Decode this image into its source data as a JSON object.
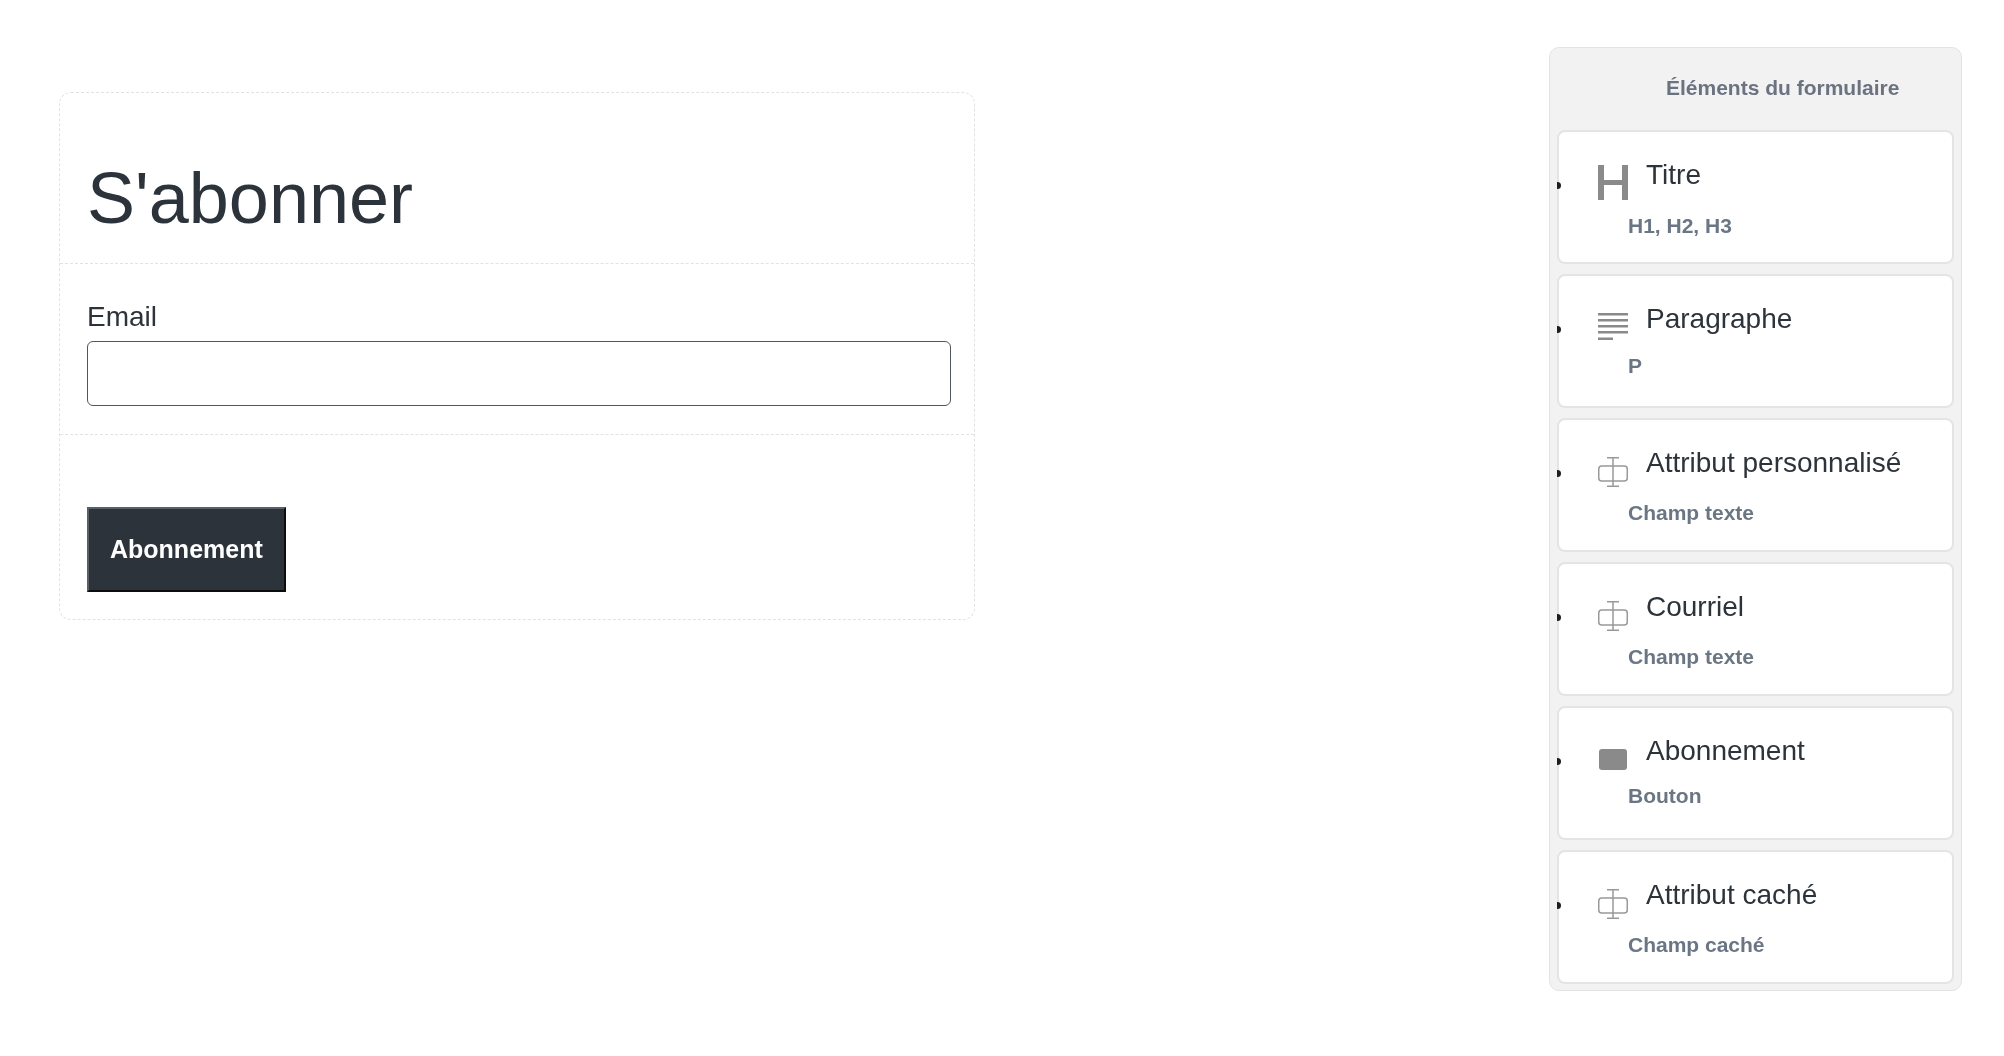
{
  "form": {
    "title": "S'abonner",
    "fields": [
      {
        "label": "Email"
      }
    ],
    "submit_button": "Abonnement"
  },
  "elements_panel": {
    "title": "Éléments du formulaire",
    "items": [
      {
        "kind": "heading",
        "name": "Titre",
        "type": "H1, H2, H3"
      },
      {
        "kind": "paragraph",
        "name": "Paragraphe",
        "type": "P"
      },
      {
        "kind": "text-field",
        "name": "Attribut personnalisé",
        "type": "Champ texte"
      },
      {
        "kind": "text-field",
        "name": "Courriel",
        "type": "Champ texte"
      },
      {
        "kind": "button",
        "name": "Abonnement",
        "type": "Bouton"
      },
      {
        "kind": "text-field",
        "name": "Attribut caché",
        "type": "Champ caché"
      }
    ]
  }
}
